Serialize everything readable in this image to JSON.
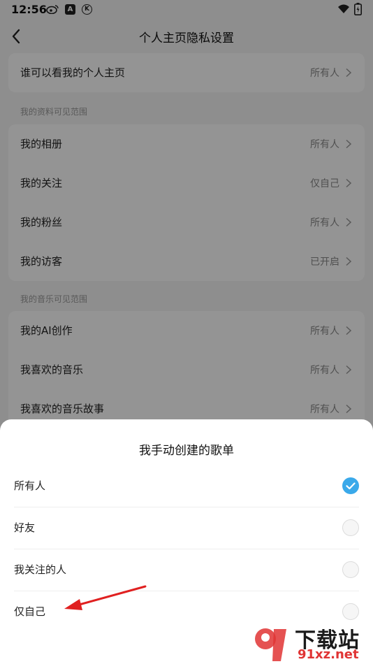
{
  "status_bar": {
    "time": "12:56",
    "icons": [
      "weibo-icon",
      "a-badge-icon",
      "k-circle-icon",
      "wifi-icon",
      "battery-icon"
    ],
    "a_badge": "A",
    "k_badge": "K"
  },
  "header": {
    "back_icon": "back-arrow-icon",
    "title": "个人主页隐私设置"
  },
  "homepage": {
    "label": "谁可以看我的个人主页",
    "value": "所有人"
  },
  "section_profile": {
    "title": "我的资料可见范围",
    "items": [
      {
        "label": "我的相册",
        "value": "所有人"
      },
      {
        "label": "我的关注",
        "value": "仅自己"
      },
      {
        "label": "我的粉丝",
        "value": "所有人"
      },
      {
        "label": "我的访客",
        "value": "已开启"
      }
    ]
  },
  "section_music": {
    "title": "我的音乐可见范围",
    "items": [
      {
        "label": "我的AI创作",
        "value": "所有人"
      },
      {
        "label": "我喜欢的音乐",
        "value": "所有人"
      },
      {
        "label": "我喜欢的音乐故事",
        "value": "所有人"
      }
    ]
  },
  "sheet": {
    "title": "我手动创建的歌单",
    "options": [
      {
        "label": "所有人",
        "selected": true
      },
      {
        "label": "好友",
        "selected": false
      },
      {
        "label": "我关注的人",
        "selected": false
      },
      {
        "label": "仅自己",
        "selected": false
      }
    ]
  },
  "colors": {
    "accent": "#3aa9ea",
    "annotation_arrow": "#e02020",
    "overlay": "rgba(0,0,0,0.42)"
  },
  "watermark": {
    "text": "下载站",
    "url": "91xz.net"
  }
}
